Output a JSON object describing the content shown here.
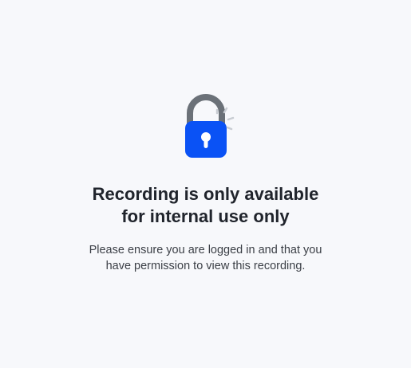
{
  "message": {
    "title_line1": "Recording is only available",
    "title_line2": "for internal use only",
    "body_line1": "Please ensure you are logged in and that you",
    "body_line2": "have permission to view this recording."
  },
  "icon": {
    "name": "padlock-icon",
    "body_color": "#0a52f5",
    "shackle_color": "#6b7178",
    "keyhole_color": "#ffffff",
    "sparkle_color": "#c9cdd3"
  },
  "colors": {
    "background": "#f7f8fb",
    "title_text": "#20242c",
    "body_text": "#3b3f46"
  }
}
